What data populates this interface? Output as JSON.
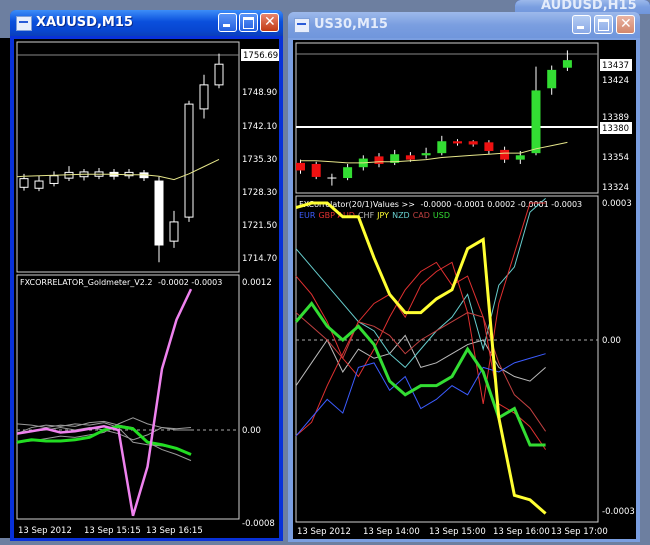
{
  "windows": {
    "left": {
      "title": "XAUUSD,M15"
    },
    "right": {
      "title": "US30,M15"
    },
    "background": {
      "title": "AUDUSD,H15"
    }
  },
  "left_price": {
    "current": "1756.69",
    "ticks": [
      "1748.90",
      "1742.10",
      "1735.30",
      "1728.30",
      "1721.50",
      "1714.70"
    ],
    "candles": [
      {
        "o": 1730.2,
        "c": 1732.0,
        "h": 1733.0,
        "l": 1729.5
      },
      {
        "o": 1730.0,
        "c": 1731.5,
        "h": 1732.6,
        "l": 1729.4
      },
      {
        "o": 1731.0,
        "c": 1732.6,
        "h": 1733.5,
        "l": 1730.4
      },
      {
        "o": 1732.1,
        "c": 1733.3,
        "h": 1734.6,
        "l": 1731.5
      },
      {
        "o": 1732.4,
        "c": 1733.4,
        "h": 1734.0,
        "l": 1731.6
      },
      {
        "o": 1732.5,
        "c": 1733.4,
        "h": 1734.2,
        "l": 1731.9
      },
      {
        "o": 1733.3,
        "c": 1732.5,
        "h": 1734.0,
        "l": 1731.8
      },
      {
        "o": 1732.6,
        "c": 1733.3,
        "h": 1734.0,
        "l": 1732.0
      },
      {
        "o": 1733.2,
        "c": 1732.2,
        "h": 1733.8,
        "l": 1731.5
      },
      {
        "o": 1731.5,
        "c": 1718.2,
        "h": 1732.4,
        "l": 1714.6
      },
      {
        "o": 1719.0,
        "c": 1723.0,
        "h": 1725.3,
        "l": 1717.6
      },
      {
        "o": 1724.0,
        "c": 1747.5,
        "h": 1748.2,
        "l": 1723.0
      },
      {
        "o": 1746.5,
        "c": 1751.5,
        "h": 1753.6,
        "l": 1744.5
      },
      {
        "o": 1751.5,
        "c": 1755.8,
        "h": 1758.0,
        "l": 1750.8
      }
    ],
    "ma": [
      1732.5,
      1732.6,
      1732.7,
      1732.8,
      1732.9,
      1732.9,
      1732.9,
      1732.8,
      1732.8,
      1732.5,
      1731.8,
      1733.0,
      1734.5,
      1736.0
    ]
  },
  "left_ind": {
    "name": "FXCORRELATOR_Goldmeter_V2.2",
    "values": "-0.0002 -0.0003",
    "top": "0.0012",
    "zero": "0.00",
    "bottom": "-0.0008",
    "pink": [
      -3e-05,
      -1e-05,
      1e-05,
      -2e-05,
      -1e-05,
      1e-05,
      3e-05,
      0.0,
      -0.0007,
      -0.0003,
      0.0005,
      0.0009,
      0.00115
    ],
    "green": [
      -0.0001,
      -8e-05,
      -9e-05,
      -9e-05,
      -8e-05,
      -6e-05,
      0.0,
      3e-05,
      1e-05,
      -0.0001,
      -0.00012,
      -0.00015,
      -0.0002
    ],
    "greys": [
      [
        -3e-05,
        2e-05,
        4e-05,
        3e-05,
        5e-05,
        4e-05,
        6e-05,
        2e-05,
        -0.0001,
        -0.00012,
        -0.00013,
        -0.00015,
        -0.0002
      ],
      [
        5e-05,
        4e-05,
        2e-05,
        4e-05,
        3e-05,
        6e-05,
        7e-05,
        4e-05,
        2e-05,
        -0.0001,
        -0.00016,
        -0.0002,
        -0.00025
      ],
      [
        -0.0001,
        -9e-05,
        -7e-05,
        -5e-05,
        -6e-05,
        -4e-05,
        -2e-05,
        5e-05,
        0.0001,
        5e-05,
        2e-05,
        1e-05,
        2e-05
      ],
      [
        -2e-05,
        -1e-05,
        0.0,
        2e-05,
        0.0,
        2e-05,
        0.0,
        -3e-05,
        -8e-05,
        -4e-05,
        2e-05,
        0.0,
        0.0
      ]
    ]
  },
  "left_dates": [
    "13 Sep 2012",
    "13 Sep 15:15",
    "13 Sep 16:15"
  ],
  "right_price": {
    "current": "13437",
    "line_label": "13380",
    "ticks": [
      "13424",
      "13389",
      "13354",
      "13324"
    ],
    "candles": [
      {
        "o": 13341,
        "c": 13334,
        "h": 13344,
        "l": 13331
      },
      {
        "o": 13340,
        "c": 13328,
        "h": 13342,
        "l": 13326
      },
      {
        "o": 13327,
        "c": 13327,
        "h": 13331,
        "l": 13320
      },
      {
        "o": 13327,
        "c": 13337,
        "h": 13340,
        "l": 13325
      },
      {
        "o": 13337,
        "c": 13345,
        "h": 13348,
        "l": 13334
      },
      {
        "o": 13347,
        "c": 13340,
        "h": 13350,
        "l": 13337
      },
      {
        "o": 13341,
        "c": 13349,
        "h": 13353,
        "l": 13339
      },
      {
        "o": 13348,
        "c": 13344,
        "h": 13351,
        "l": 13342
      },
      {
        "o": 13348,
        "c": 13350,
        "h": 13355,
        "l": 13345
      },
      {
        "o": 13350,
        "c": 13361,
        "h": 13366,
        "l": 13348
      },
      {
        "o": 13361,
        "c": 13359,
        "h": 13363,
        "l": 13357
      },
      {
        "o": 13361,
        "c": 13358,
        "h": 13362,
        "l": 13356
      },
      {
        "o": 13360,
        "c": 13352,
        "h": 13362,
        "l": 13349
      },
      {
        "o": 13353,
        "c": 13344,
        "h": 13356,
        "l": 13341
      },
      {
        "o": 13344,
        "c": 13348,
        "h": 13352,
        "l": 13340
      },
      {
        "o": 13350,
        "c": 13408,
        "h": 13430,
        "l": 13348
      },
      {
        "o": 13410,
        "c": 13427,
        "h": 13431,
        "l": 13404
      },
      {
        "o": 13429,
        "c": 13436,
        "h": 13445,
        "l": 13426
      }
    ],
    "ma": [
      13343,
      13343,
      13342,
      13341,
      13341,
      13342,
      13342,
      13343,
      13344,
      13346,
      13347,
      13348,
      13349,
      13350,
      13350,
      13354,
      13357,
      13360
    ],
    "top_line": 13448,
    "white_line": 13381
  },
  "right_ind": {
    "name": "FXCorrelator(20/1)Values >>",
    "values": "-0.0000 -0.0001 0.0002 -0.0001 -0.0003",
    "top": "0.0003",
    "zero": "0.00",
    "bottom": "-0.0003",
    "legend": [
      {
        "code": "EUR",
        "color": "#3c5cff"
      },
      {
        "code": "GBP",
        "color": "#e03030"
      },
      {
        "code": "AUD",
        "color": "#e03030"
      },
      {
        "code": "CHF",
        "color": "#bbbbbb"
      },
      {
        "code": "JPY",
        "color": "#ffff33"
      },
      {
        "code": "NZD",
        "color": "#66cccc"
      },
      {
        "code": "CAD",
        "color": "#c04040"
      },
      {
        "code": "USD",
        "color": "#33dd33"
      }
    ],
    "series": {
      "JPY": [
        0.00029,
        0.0003,
        0.0003,
        0.00027,
        0.00027,
        0.00018,
        0.0001,
        6e-05,
        6e-05,
        9e-05,
        0.00011,
        0.0002,
        0.00022,
        -0.00017,
        -0.00034,
        -0.00035,
        -0.00038
      ],
      "USD": [
        4e-05,
        8e-05,
        3e-05,
        0.0,
        3e-05,
        -1e-05,
        -9e-05,
        -0.00012,
        -0.0001,
        -0.0001,
        -8e-05,
        -2e-05,
        -7e-05,
        -0.00017,
        -0.00015,
        -0.00023,
        -0.00023
      ],
      "NZD": [
        0.0002,
        0.00016,
        0.00012,
        8e-05,
        4e-05,
        2e-05,
        -3e-05,
        -6e-05,
        -2e-05,
        2e-05,
        5e-05,
        0.0001,
        -2e-05,
        0.00012,
        0.00016,
        0.00028,
        0.00031
      ],
      "AUD": [
        -0.00021,
        -0.00018,
        -0.0001,
        -3e-05,
        4e-05,
        8e-05,
        0.0001,
        5e-05,
        0.00012,
        0.00015,
        0.00017,
        6e-05,
        -0.00014,
        8e-05,
        0.00019,
        0.0003,
        0.0003
      ],
      "GBP": [
        0.00014,
        0.0001,
        4e-05,
        -4e-05,
        -8e-05,
        -2e-05,
        5e-05,
        0.00011,
        0.00015,
        0.00017,
        0.00012,
        0.00014,
        5e-05,
        -0.00014,
        -0.00016,
        -0.00019,
        -0.00024
      ],
      "EUR": [
        -0.00021,
        -0.00017,
        -0.00013,
        -0.00016,
        -6e-05,
        -5e-05,
        -0.00011,
        -8e-05,
        -0.00015,
        -0.00013,
        -0.0001,
        -0.00012,
        -6e-05,
        -7e-05,
        -5e-05,
        -4e-05,
        -3e-05
      ],
      "CHF": [
        -0.0001,
        -5e-05,
        0.0,
        -7e-05,
        -2e-05,
        -4e-05,
        -3e-05,
        1e-05,
        -6e-05,
        -5e-05,
        -3e-05,
        -1e-05,
        0.0,
        -6e-05,
        -8e-05,
        -9e-05,
        -6e-05
      ],
      "CAD": [
        6e-05,
        3e-05,
        0.0,
        -4e-05,
        4e-05,
        3e-05,
        1e-05,
        -3e-05,
        0.0,
        2e-05,
        4e-05,
        6e-05,
        5e-05,
        -5e-05,
        -0.00012,
        -0.00015,
        -0.0002
      ]
    }
  },
  "right_dates": [
    "13 Sep 2012",
    "13 Sep 14:00",
    "13 Sep 15:00",
    "13 Sep 16:00",
    "13 Sep 17:00"
  ],
  "colors": {
    "bull_left": "#ffffff",
    "bull_right": "#33dd33",
    "bear_right": "#ee1111",
    "ma": "#e6e68a",
    "pink": "#ee82ee",
    "green": "#22dd22"
  }
}
